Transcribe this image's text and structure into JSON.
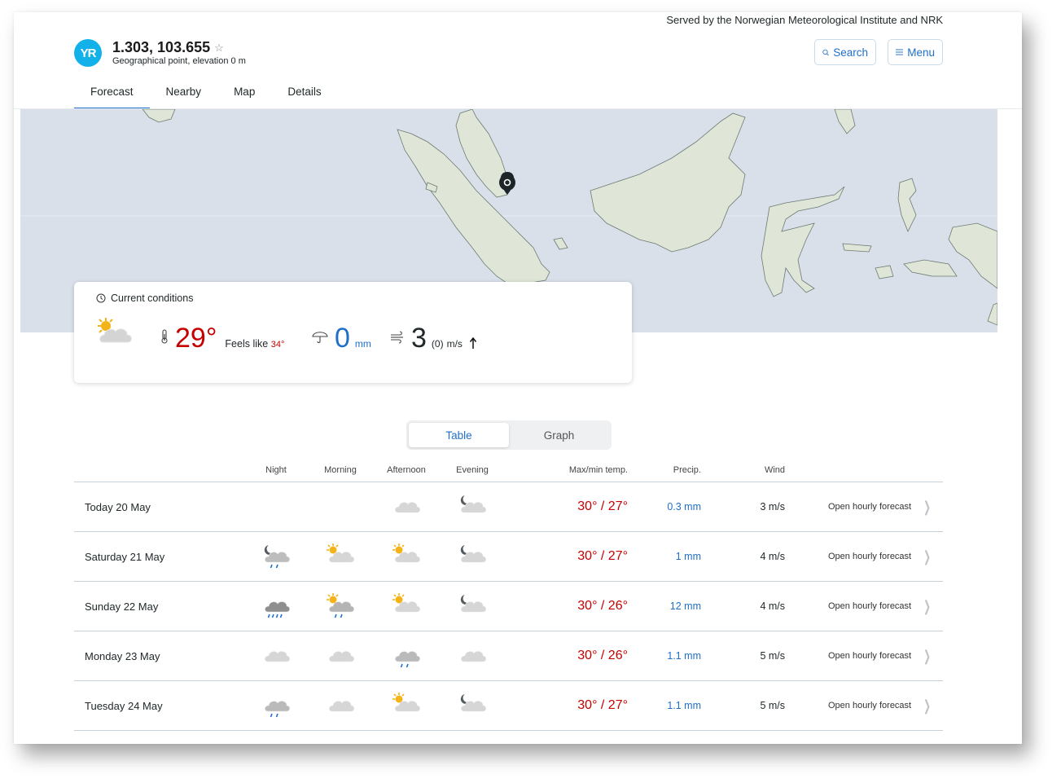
{
  "header": {
    "served_by": "Served by the Norwegian Meteorological Institute and NRK",
    "logo_text": "YR",
    "location_title": "1.303, 103.655",
    "location_subtitle": "Geographical point, elevation 0 m",
    "favorite_icon": "star-outline-icon",
    "search_label": "Search",
    "menu_label": "Menu"
  },
  "tabs": [
    {
      "label": "Forecast",
      "active": true
    },
    {
      "label": "Nearby",
      "active": false
    },
    {
      "label": "Map",
      "active": false
    },
    {
      "label": "Details",
      "active": false
    }
  ],
  "map": {
    "marker_icon": "location-pin-icon"
  },
  "current": {
    "heading": "Current conditions",
    "symbol": "partly-cloudy-day",
    "temperature": "29°",
    "feels_like_label": "Feels like",
    "feels_like_value": "34°",
    "precip_value": "0",
    "precip_unit": "mm",
    "wind_value": "3",
    "wind_gust": "(0)",
    "wind_unit": "m/s",
    "wind_direction_icon": "arrow-up-icon"
  },
  "view_toggle": {
    "options": [
      "Table",
      "Graph"
    ],
    "selected": "Table"
  },
  "forecast_table": {
    "headers": {
      "night": "Night",
      "morning": "Morning",
      "afternoon": "Afternoon",
      "evening": "Evening",
      "temp": "Max/min temp.",
      "precip": "Precip.",
      "wind": "Wind"
    },
    "rows": [
      {
        "date": "Today 20 May",
        "night": "",
        "morning": "",
        "afternoon": "cloudy",
        "evening": "partly-cloudy-night",
        "temp": "30° / 27°",
        "precip": "0.3 mm",
        "wind": "3 m/s",
        "open": "Open hourly forecast"
      },
      {
        "date": "Saturday 21 May",
        "night": "light-rain-night",
        "morning": "partly-cloudy-day",
        "afternoon": "partly-cloudy-day",
        "evening": "partly-cloudy-night",
        "temp": "30° / 27°",
        "precip": "1 mm",
        "wind": "4 m/s",
        "open": "Open hourly forecast"
      },
      {
        "date": "Sunday 22 May",
        "night": "heavy-rain",
        "morning": "light-rain-day",
        "afternoon": "partly-cloudy-day",
        "evening": "partly-cloudy-night",
        "temp": "30° / 26°",
        "precip": "12 mm",
        "wind": "4 m/s",
        "open": "Open hourly forecast"
      },
      {
        "date": "Monday 23 May",
        "night": "cloudy",
        "morning": "cloudy",
        "afternoon": "light-rain",
        "evening": "cloudy",
        "temp": "30° / 26°",
        "precip": "1.1 mm",
        "wind": "5 m/s",
        "open": "Open hourly forecast"
      },
      {
        "date": "Tuesday 24 May",
        "night": "light-rain",
        "morning": "cloudy",
        "afternoon": "partly-cloudy-day",
        "evening": "partly-cloudy-night",
        "temp": "30° / 27°",
        "precip": "1.1 mm",
        "wind": "5 m/s",
        "open": "Open hourly forecast"
      }
    ]
  }
}
